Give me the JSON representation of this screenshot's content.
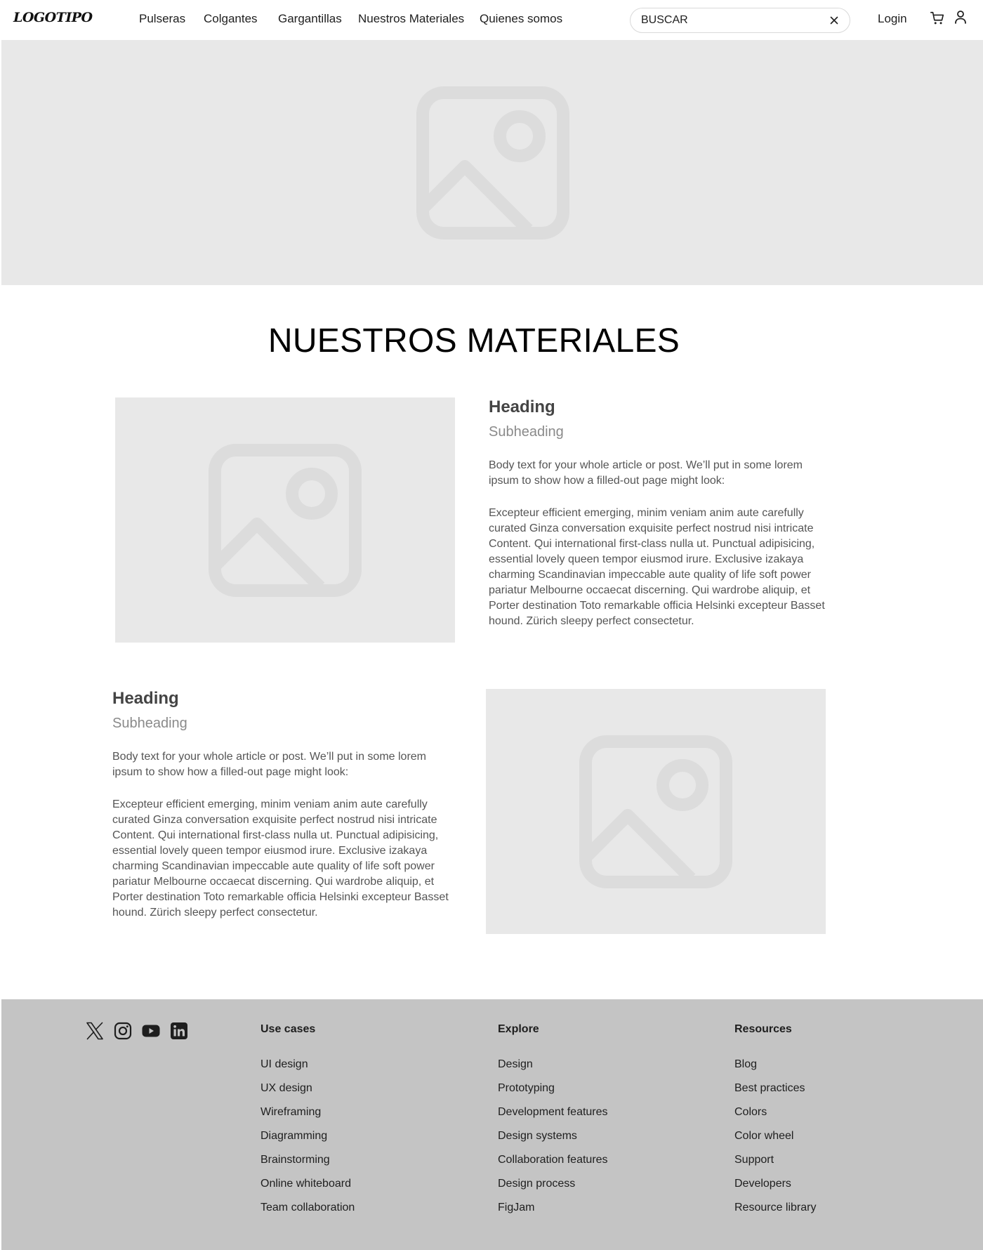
{
  "header": {
    "logo": "LOGOTIPO",
    "nav": [
      "Pulseras",
      "Colgantes",
      "Gargantillas",
      "Nuestros Materiales",
      "Quienes somos"
    ],
    "search_placeholder": "BUSCAR",
    "login": "Login",
    "icons": [
      "close-icon",
      "cart-icon",
      "user-icon"
    ]
  },
  "hero": {
    "icon": "image-placeholder-icon"
  },
  "main": {
    "title": "NUESTROS MATERIALES",
    "sections": [
      {
        "heading": "Heading",
        "subheading": "Subheading",
        "intro": "Body text for your whole article or post. We’ll put in some lorem ipsum to show how a filled-out page might look:",
        "body": "Excepteur efficient emerging, minim veniam anim aute carefully curated Ginza conversation exquisite perfect nostrud nisi intricate Content. Qui  international first-class nulla ut. Punctual adipisicing, essential lovely queen tempor eiusmod irure. Exclusive izakaya charming Scandinavian impeccable aute quality of life soft power pariatur Melbourne occaecat discerning. Qui wardrobe aliquip, et Porter destination Toto remarkable officia Helsinki excepteur Basset hound. Zürich sleepy perfect consectetur."
      },
      {
        "heading": "Heading",
        "subheading": "Subheading",
        "intro": "Body text for your whole article or post. We’ll put in some lorem ipsum to show how a filled-out page might look:",
        "body": "Excepteur efficient emerging, minim veniam anim aute carefully curated Ginza conversation exquisite perfect nostrud nisi intricate Content. Qui  international first-class nulla ut. Punctual adipisicing, essential lovely queen tempor eiusmod irure. Exclusive izakaya charming Scandinavian impeccable aute quality of life soft power pariatur Melbourne occaecat discerning. Qui wardrobe aliquip, et Porter destination Toto remarkable officia Helsinki excepteur Basset hound. Zürich sleepy perfect consectetur."
      }
    ]
  },
  "footer": {
    "social": [
      "x-icon",
      "instagram-icon",
      "youtube-icon",
      "linkedin-icon"
    ],
    "columns": [
      {
        "title": "Use cases",
        "items": [
          "UI design",
          "UX design",
          "Wireframing",
          "Diagramming",
          "Brainstorming",
          "Online whiteboard",
          "Team collaboration"
        ]
      },
      {
        "title": "Explore",
        "items": [
          "Design",
          "Prototyping",
          "Development features",
          "Design systems",
          "Collaboration features",
          "Design process",
          "FigJam"
        ]
      },
      {
        "title": "Resources",
        "items": [
          "Blog",
          "Best practices",
          "Colors",
          "Color wheel",
          "Support",
          "Developers",
          "Resource library"
        ]
      }
    ]
  },
  "colors": {
    "placeholder_bg": "#e8e8e8",
    "placeholder_icon": "#dcdcdc",
    "footer_bg": "#c4c4c4",
    "text": "#1e1e1e"
  }
}
